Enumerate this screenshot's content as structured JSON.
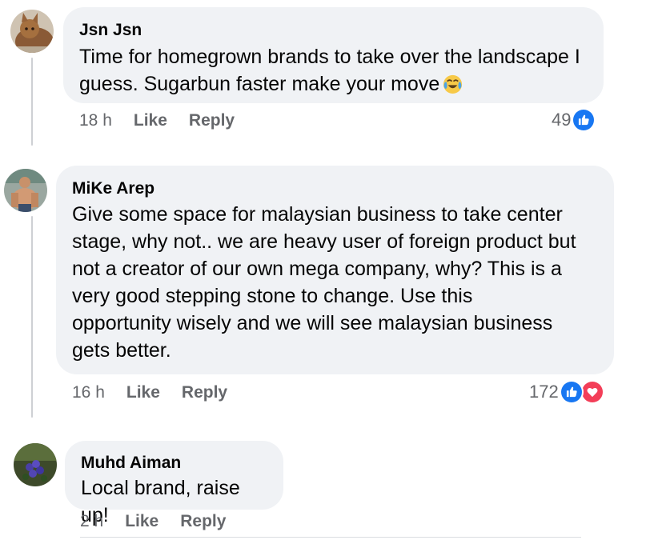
{
  "comments": [
    {
      "author": "Jsn Jsn",
      "text": "Time for homegrown brands to take over the landscape I\nguess. Sugarbun faster make your move",
      "emoji": "laughing-crying-emoji",
      "time": "18 h",
      "like_label": "Like",
      "reply_label": "Reply",
      "reaction_count": "49",
      "reaction_icons": [
        "like-icon"
      ]
    },
    {
      "author": "MiKe Arep",
      "text": "Give some space for malaysian business to take center\nstage, why not.. we are heavy user of foreign product but\nnot a creator of our own mega company, why? This is a\nvery good stepping stone to change. Use this\nopportunity wisely and we will see malaysian business\ngets better.",
      "time": "16 h",
      "like_label": "Like",
      "reply_label": "Reply",
      "reaction_count": "172",
      "reaction_icons": [
        "like-icon",
        "love-icon"
      ]
    },
    {
      "author": "Muhd Aiman",
      "text": "Local brand, raise up!",
      "time": "2 h",
      "like_label": "Like",
      "reply_label": "Reply"
    }
  ],
  "colors": {
    "bubble": "#f0f2f5",
    "meta_text": "#65676b",
    "like_blue": "#1877f2",
    "love_red": "#f33e58"
  }
}
